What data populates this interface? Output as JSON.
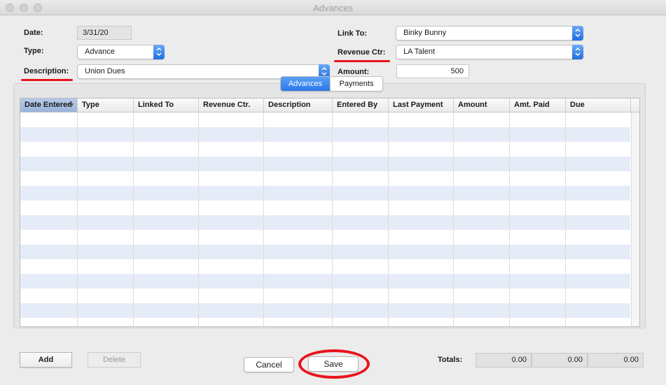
{
  "window": {
    "title": "Advances"
  },
  "form": {
    "date_label": "Date:",
    "date_value": "3/31/20",
    "type_label": "Type:",
    "type_value": "Advance",
    "description_label": "Description:",
    "description_value": "Union Dues",
    "link_to_label": "Link To:",
    "link_to_value": "Binky Bunny",
    "revenue_ctr_label": "Revenue Ctr:",
    "revenue_ctr_value": "LA Talent",
    "amount_label": "Amount:",
    "amount_value": "500"
  },
  "tabs": {
    "advances": "Advances",
    "payments": "Payments",
    "selected": "Advances"
  },
  "table": {
    "columns": [
      "Date Entered",
      "Type",
      "Linked To",
      "Revenue Ctr.",
      "Description",
      "Entered By",
      "Last Payment",
      "Amount",
      "Amt. Paid",
      "Due"
    ],
    "sorted_column": "Date Entered",
    "rows": []
  },
  "buttons": {
    "add": "Add",
    "delete": "Delete",
    "cancel": "Cancel",
    "save": "Save"
  },
  "totals": {
    "label": "Totals:",
    "values": [
      "0.00",
      "0.00",
      "0.00"
    ]
  },
  "annotations": {
    "highlight_color": "#e8141c"
  }
}
